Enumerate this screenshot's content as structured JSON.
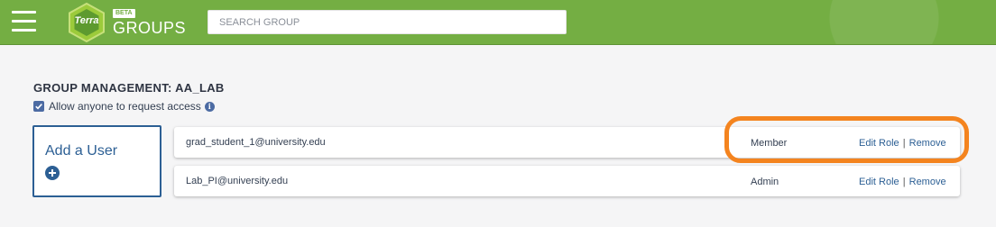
{
  "header": {
    "logo_text": "Terra",
    "beta_badge": "BETA",
    "app_title": "GROUPS",
    "search_placeholder": "SEARCH GROUP",
    "brand_color": "#74ae43"
  },
  "page": {
    "title": "GROUP MANAGEMENT: AA_LAB",
    "allow_access_label": "Allow anyone to request access",
    "allow_access_checked": true
  },
  "add_user": {
    "label": "Add a User"
  },
  "members": [
    {
      "email": "grad_student_1@university.edu",
      "role": "Member",
      "edit_label": "Edit Role",
      "separator": "|",
      "remove_label": "Remove",
      "highlighted": true
    },
    {
      "email": "Lab_PI@university.edu",
      "role": "Admin",
      "edit_label": "Edit Role",
      "separator": "|",
      "remove_label": "Remove",
      "highlighted": false
    }
  ],
  "highlight_color": "#f4841f"
}
